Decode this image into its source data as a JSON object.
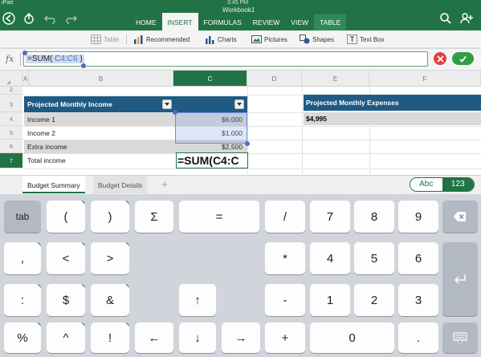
{
  "status": {
    "carrier": "iPad",
    "time": "3:45 PM"
  },
  "ribbon": {
    "workbook_title": "Workbook1",
    "tabs": [
      {
        "label": "HOME",
        "active": false
      },
      {
        "label": "INSERT",
        "active": true
      },
      {
        "label": "FORMULAS",
        "active": false
      },
      {
        "label": "REVIEW",
        "active": false
      },
      {
        "label": "VIEW",
        "active": false
      },
      {
        "label": "TABLE",
        "active": false
      }
    ],
    "colors": {
      "accent": "#217346",
      "table_header": "#1e5a84",
      "cancel": "#e0403a",
      "confirm": "#2f9e44"
    }
  },
  "toolbar": {
    "table": "Table",
    "recommended": "Recommended",
    "charts": "Charts",
    "pictures": "Pictures",
    "shapes": "Shapes",
    "textbox": "Text Box"
  },
  "formula_bar": {
    "fx": "fx",
    "prefix": "=SUM(",
    "ref": " C4:C6 ",
    "suffix": ")"
  },
  "grid": {
    "columns": [
      "A",
      "B",
      "C",
      "D",
      "E",
      "F"
    ],
    "rows": [
      "2",
      "3",
      "4",
      "5",
      "6",
      "7"
    ],
    "active_column": "C",
    "active_row": "7",
    "income_table": {
      "header": "Projected Monthly Income",
      "rows": [
        {
          "label": "Income 1",
          "value": "$6,000"
        },
        {
          "label": "Income 2",
          "value": "$1,000"
        },
        {
          "label": "Extra income",
          "value": "$2,500"
        },
        {
          "label": "Total income",
          "value": "=SUM(C4:C"
        }
      ]
    },
    "expense_table": {
      "header": "Projected Monthly Expenses",
      "value": "$4,995"
    }
  },
  "sheets": {
    "tabs": [
      "Budget Summary",
      "Budget Details"
    ],
    "add": "+",
    "mode_abc": "Abc",
    "mode_num": "123"
  },
  "keyboard": {
    "row1": [
      "tab",
      "(",
      ")",
      "Σ",
      "=",
      "/",
      "7",
      "8",
      "9"
    ],
    "row2": [
      ",",
      "<",
      ">",
      "*",
      "4",
      "5",
      "6"
    ],
    "row3": [
      ":",
      "$",
      "&",
      "↑",
      "-",
      "1",
      "2",
      "3"
    ],
    "row4": [
      "%",
      "^",
      "!",
      "←",
      "↓",
      "→",
      "+",
      "0",
      "."
    ]
  }
}
